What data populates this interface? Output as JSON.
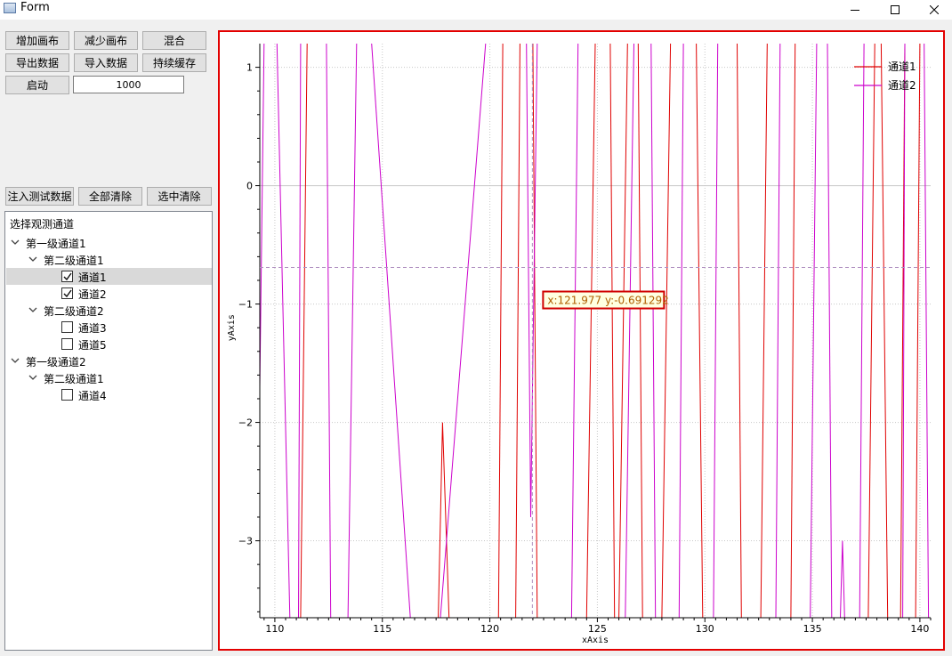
{
  "window": {
    "title": "Form"
  },
  "toolbar": {
    "add_canvas": "增加画布",
    "remove_canvas": "减少画布",
    "mix": "混合",
    "export_data": "导出数据",
    "import_data": "导入数据",
    "persist_cache": "持续缓存",
    "start": "启动",
    "count_value": "1000"
  },
  "actions": {
    "inject_test_data": "注入测试数据",
    "clear_all": "全部清除",
    "clear_selected": "选中清除"
  },
  "tree": {
    "header": "选择观测通道",
    "rows": [
      {
        "label": "第一级通道1",
        "expandable": true,
        "checkable": false
      },
      {
        "label": "第二级通道1",
        "expandable": true,
        "checkable": false
      },
      {
        "label": "通道1",
        "checkable": true,
        "checked": true,
        "selected": true
      },
      {
        "label": "通道2",
        "checkable": true,
        "checked": true
      },
      {
        "label": "第二级通道2",
        "expandable": true,
        "checkable": false
      },
      {
        "label": "通道3",
        "checkable": true,
        "checked": false
      },
      {
        "label": "通道5",
        "checkable": true,
        "checked": false
      },
      {
        "label": "第一级通道2",
        "expandable": true,
        "checkable": false
      },
      {
        "label": "第二级通道1",
        "expandable": true,
        "checkable": false
      },
      {
        "label": "通道4",
        "checkable": true,
        "checked": false
      }
    ]
  },
  "chart_data": {
    "type": "line",
    "xlabel": "xAxis",
    "ylabel": "yAxis",
    "xlim": [
      109.3,
      140.5
    ],
    "ylim": [
      -3.65,
      1.2
    ],
    "x_ticks": [
      110,
      115,
      120,
      125,
      130,
      135,
      140
    ],
    "y_ticks": [
      1,
      0,
      -1,
      -2,
      -3
    ],
    "grid": true,
    "legend_position": "top-right",
    "colors": {
      "series1": "#e00000",
      "series2": "#cc00cc",
      "cursor": "#b090c0",
      "tooltip_border": "#d00000",
      "tooltip_text": "#b06000"
    },
    "cursor": {
      "x": 121.977,
      "y": -0.691292,
      "label": "x:121.977 y:-0.691292"
    },
    "series": [
      {
        "name": "通道1",
        "segments": [
          [
            [
              111.2,
              -3.65
            ],
            [
              111.5,
              1.2
            ]
          ],
          [
            [
              117.6,
              -3.65
            ],
            [
              117.8,
              -2.0
            ],
            [
              118.1,
              -3.65
            ]
          ],
          [
            [
              120.4,
              -3.65
            ],
            [
              120.6,
              1.2
            ]
          ],
          [
            [
              121.4,
              1.2
            ],
            [
              121.2,
              -3.65
            ]
          ],
          [
            [
              122.0,
              1.2
            ],
            [
              122.2,
              -3.65
            ]
          ],
          [
            [
              124.9,
              1.2
            ],
            [
              124.5,
              -3.65
            ]
          ],
          [
            [
              125.6,
              1.2
            ],
            [
              125.8,
              -3.65
            ]
          ],
          [
            [
              126.4,
              1.2
            ],
            [
              126.0,
              -3.65
            ]
          ],
          [
            [
              126.9,
              1.2
            ],
            [
              127.1,
              -3.65
            ]
          ],
          [
            [
              128.4,
              1.2
            ],
            [
              128.0,
              -3.65
            ]
          ],
          [
            [
              129.6,
              1.2
            ],
            [
              129.9,
              -3.65
            ]
          ],
          [
            [
              131.7,
              -3.65
            ],
            [
              131.5,
              1.2
            ]
          ],
          [
            [
              132.6,
              -3.65
            ],
            [
              132.9,
              1.2
            ]
          ],
          [
            [
              134.2,
              1.2
            ],
            [
              134.0,
              -3.65
            ]
          ],
          [
            [
              137.6,
              -3.65
            ],
            [
              137.9,
              1.2
            ]
          ],
          [
            [
              138.2,
              1.2
            ],
            [
              138.5,
              -3.65
            ]
          ],
          [
            [
              139.1,
              -3.65
            ],
            [
              139.3,
              1.2
            ]
          ],
          [
            [
              139.8,
              -3.65
            ],
            [
              140.0,
              1.2
            ]
          ]
        ]
      },
      {
        "name": "通道2",
        "segments": [
          [
            [
              109.3,
              -1.7
            ],
            [
              109.5,
              1.2
            ]
          ],
          [
            [
              110.1,
              1.2
            ],
            [
              110.7,
              -3.65
            ]
          ],
          [
            [
              111.1,
              -3.65
            ],
            [
              111.2,
              1.2
            ]
          ],
          [
            [
              112.6,
              -3.65
            ],
            [
              112.4,
              1.2
            ]
          ],
          [
            [
              113.4,
              -3.65
            ],
            [
              113.8,
              1.2
            ]
          ],
          [
            [
              114.5,
              1.2
            ],
            [
              116.3,
              -3.65
            ]
          ],
          [
            [
              117.7,
              -3.65
            ],
            [
              119.8,
              1.2
            ]
          ],
          [
            [
              121.7,
              1.2
            ],
            [
              121.9,
              -2.8
            ],
            [
              122.2,
              1.2
            ]
          ],
          [
            [
              123.8,
              -3.65
            ],
            [
              124.1,
              1.2
            ]
          ],
          [
            [
              126.3,
              -3.65
            ],
            [
              126.7,
              1.2
            ]
          ],
          [
            [
              127.7,
              -3.65
            ],
            [
              127.5,
              1.2
            ]
          ],
          [
            [
              129.0,
              1.2
            ],
            [
              128.8,
              -3.65
            ]
          ],
          [
            [
              130.4,
              -3.65
            ],
            [
              130.6,
              1.2
            ]
          ],
          [
            [
              133.3,
              -3.65
            ],
            [
              133.5,
              1.2
            ]
          ],
          [
            [
              134.9,
              -3.65
            ],
            [
              135.2,
              1.2
            ]
          ],
          [
            [
              135.7,
              1.2
            ],
            [
              135.9,
              -3.65
            ]
          ],
          [
            [
              136.3,
              -3.65
            ],
            [
              136.4,
              -3.0
            ],
            [
              136.5,
              -3.65
            ]
          ],
          [
            [
              137.2,
              -3.65
            ],
            [
              137.4,
              1.2
            ]
          ],
          [
            [
              139.2,
              -3.65
            ],
            [
              139.3,
              1.2
            ]
          ],
          [
            [
              140.2,
              1.2
            ],
            [
              140.4,
              -3.65
            ]
          ]
        ]
      }
    ]
  }
}
